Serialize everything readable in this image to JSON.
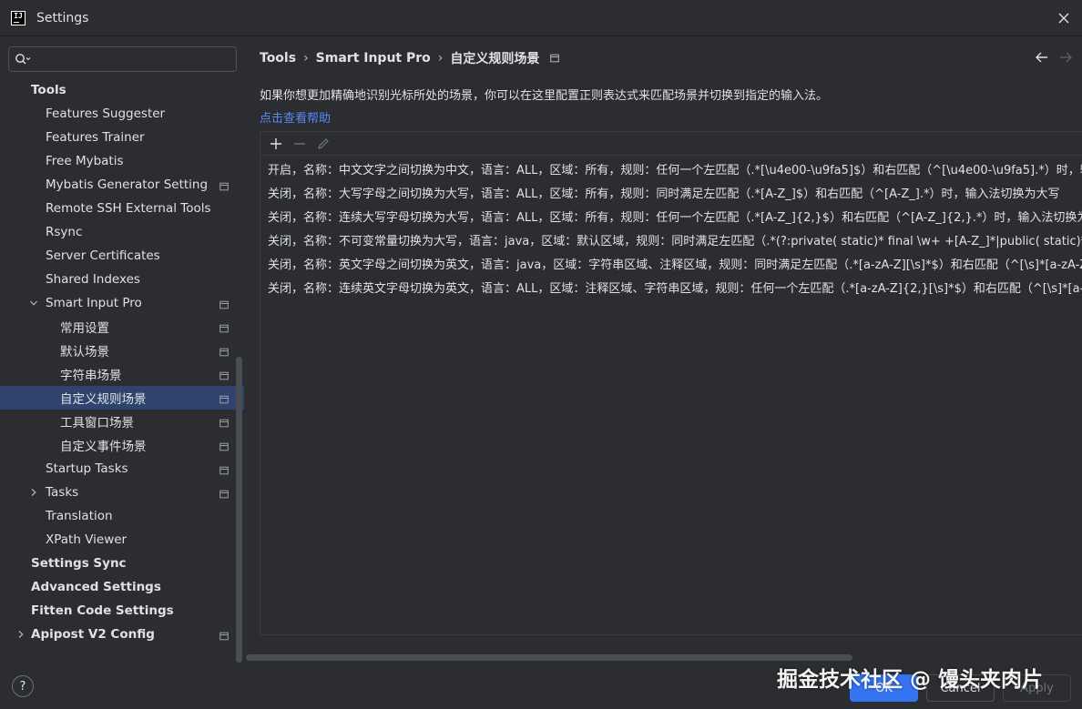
{
  "window": {
    "title": "Settings"
  },
  "search": {
    "placeholder": "",
    "value": ""
  },
  "sidebar": {
    "items": [
      {
        "label": "Tools",
        "bold": true,
        "indent": 0,
        "chevron": "none",
        "project": false,
        "selected": false
      },
      {
        "label": "Features Suggester",
        "bold": false,
        "indent": 1,
        "chevron": "none",
        "project": false,
        "selected": false
      },
      {
        "label": "Features Trainer",
        "bold": false,
        "indent": 1,
        "chevron": "none",
        "project": false,
        "selected": false
      },
      {
        "label": "Free Mybatis",
        "bold": false,
        "indent": 1,
        "chevron": "none",
        "project": false,
        "selected": false
      },
      {
        "label": "Mybatis Generator Setting",
        "bold": false,
        "indent": 1,
        "chevron": "none",
        "project": true,
        "selected": false
      },
      {
        "label": "Remote SSH External Tools",
        "bold": false,
        "indent": 1,
        "chevron": "none",
        "project": false,
        "selected": false
      },
      {
        "label": "Rsync",
        "bold": false,
        "indent": 1,
        "chevron": "none",
        "project": false,
        "selected": false
      },
      {
        "label": "Server Certificates",
        "bold": false,
        "indent": 1,
        "chevron": "none",
        "project": false,
        "selected": false
      },
      {
        "label": "Shared Indexes",
        "bold": false,
        "indent": 1,
        "chevron": "none",
        "project": false,
        "selected": false
      },
      {
        "label": "Smart Input Pro",
        "bold": false,
        "indent": 1,
        "chevron": "down",
        "project": true,
        "selected": false
      },
      {
        "label": "常用设置",
        "bold": false,
        "indent": 2,
        "chevron": "none",
        "project": true,
        "selected": false
      },
      {
        "label": "默认场景",
        "bold": false,
        "indent": 2,
        "chevron": "none",
        "project": true,
        "selected": false
      },
      {
        "label": "字符串场景",
        "bold": false,
        "indent": 2,
        "chevron": "none",
        "project": true,
        "selected": false
      },
      {
        "label": "自定义规则场景",
        "bold": false,
        "indent": 2,
        "chevron": "none",
        "project": true,
        "selected": true
      },
      {
        "label": "工具窗口场景",
        "bold": false,
        "indent": 2,
        "chevron": "none",
        "project": true,
        "selected": false
      },
      {
        "label": "自定义事件场景",
        "bold": false,
        "indent": 2,
        "chevron": "none",
        "project": true,
        "selected": false
      },
      {
        "label": "Startup Tasks",
        "bold": false,
        "indent": 1,
        "chevron": "none",
        "project": true,
        "selected": false
      },
      {
        "label": "Tasks",
        "bold": false,
        "indent": 1,
        "chevron": "right",
        "project": true,
        "selected": false
      },
      {
        "label": "Translation",
        "bold": false,
        "indent": 1,
        "chevron": "none",
        "project": false,
        "selected": false
      },
      {
        "label": "XPath Viewer",
        "bold": false,
        "indent": 1,
        "chevron": "none",
        "project": false,
        "selected": false
      },
      {
        "label": "Settings Sync",
        "bold": true,
        "indent": 0,
        "chevron": "none",
        "project": false,
        "selected": false
      },
      {
        "label": "Advanced Settings",
        "bold": true,
        "indent": 0,
        "chevron": "none",
        "project": false,
        "selected": false
      },
      {
        "label": "Fitten Code Settings",
        "bold": true,
        "indent": 0,
        "chevron": "none",
        "project": false,
        "selected": false
      },
      {
        "label": "Apipost V2 Config",
        "bold": true,
        "indent": 0,
        "chevron": "right",
        "project": true,
        "selected": false
      }
    ]
  },
  "breadcrumb": {
    "items": [
      "Tools",
      "Smart Input Pro",
      "自定义规则场景"
    ]
  },
  "page": {
    "description": "如果你想更加精确地识别光标所处的场景，你可以在这里配置正则表达式来匹配场景并切换到指定的输入法。",
    "help_link": "点击查看帮助"
  },
  "rules": [
    "开启，名称：中文文字之间切换为中文，语言：ALL，区域：所有，规则：任何一个左匹配（.*[\\u4e00-\\u9fa5]$）和右匹配（^[\\u4e00-\\u9fa5].*）时，输",
    "关闭，名称：大写字母之间切换为大写，语言：ALL，区域：所有，规则：同时满足左匹配（.*[A-Z_]$）和右匹配（^[A-Z_].*）时，输入法切换为大写",
    "关闭，名称：连续大写字母切换为大写，语言：ALL，区域：所有，规则：任何一个左匹配（.*[A-Z_]{2,}$）和右匹配（^[A-Z_]{2,}.*）时，输入法切换为大写",
    "关闭，名称：不可变常量切换为大写，语言：java，区域：默认区域，规则：同时满足左匹配（.*(?:private( static)* final \\w+ +[A-Z_]*|public( static)* fina",
    "关闭，名称：英文字母之间切换为英文，语言：java，区域：字符串区域、注释区域，规则：同时满足左匹配（.*[a-zA-Z][\\s]*$）和右匹配（^[\\s]*[a-zA-Z].",
    "关闭，名称：连续英文字母切换为英文，语言：ALL，区域：注释区域、字符串区域，规则：任何一个左匹配（.*[a-zA-Z]{2,}[\\s]*$）和右匹配（^[\\s]*[a-zA-"
  ],
  "buttons": {
    "help": "?",
    "ok": "OK",
    "cancel": "Cancel",
    "apply": "Apply"
  },
  "watermark": "掘金技术社区 @ 馒头夹肉片",
  "colors": {
    "accent": "#3574f0",
    "selection": "#2e436e",
    "link": "#548af7",
    "background": "#2b2d30"
  }
}
